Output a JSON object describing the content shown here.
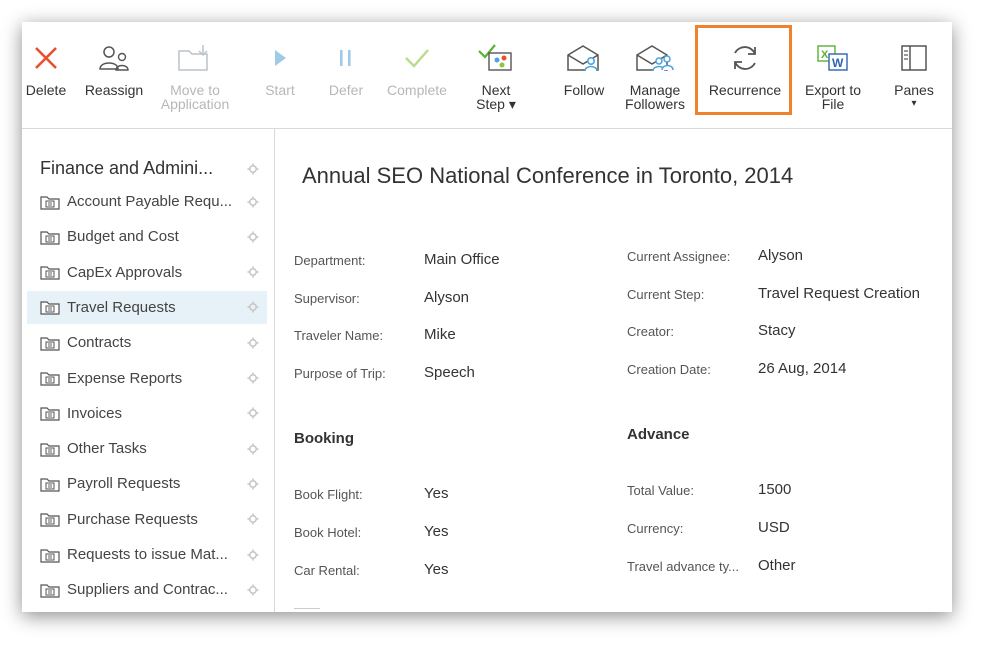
{
  "toolbar": {
    "delete": "Delete",
    "reassign": "Reassign",
    "move_to_app_1": "Move to",
    "move_to_app_2": "Application",
    "start": "Start",
    "defer": "Defer",
    "complete": "Complete",
    "next_step_1": "Next",
    "next_step_2": "Step ▾",
    "follow": "Follow",
    "manage_followers_1": "Manage",
    "manage_followers_2": "Followers",
    "recurrence": "Recurrence",
    "export_to_file_1": "Export to",
    "export_to_file_2": "File",
    "panes_1": "Panes",
    "panes_2": "▾"
  },
  "sidebar": {
    "title": "Finance and Admini...",
    "items": [
      {
        "label": "Account Payable Requ..."
      },
      {
        "label": "Budget and Cost"
      },
      {
        "label": "CapEx Approvals"
      },
      {
        "label": "Travel Requests"
      },
      {
        "label": "Contracts"
      },
      {
        "label": "Expense Reports"
      },
      {
        "label": "Invoices"
      },
      {
        "label": "Other Tasks"
      },
      {
        "label": "Payroll Requests"
      },
      {
        "label": "Purchase Requests"
      },
      {
        "label": "Requests to issue Mat..."
      },
      {
        "label": "Suppliers and Contrac..."
      }
    ]
  },
  "detail": {
    "title": "Annual SEO National Conference in Toronto, 2014",
    "left_fields": [
      {
        "label": "Department:",
        "value": "Main Office"
      },
      {
        "label": "Supervisor:",
        "value": "Alyson"
      },
      {
        "label": "Traveler Name:",
        "value": "Mike"
      },
      {
        "label": "Purpose of Trip:",
        "value": "Speech"
      }
    ],
    "right_fields": [
      {
        "label": "Current Assignee:",
        "value": "Alyson"
      },
      {
        "label": "Current Step:",
        "value": "Travel Request Creation"
      },
      {
        "label": "Creator:",
        "value": "Stacy"
      },
      {
        "label": "Creation Date:",
        "value": "26 Aug, 2014"
      }
    ],
    "booking_title": "Booking",
    "booking_fields": [
      {
        "label": "Book Flight:",
        "value": "Yes"
      },
      {
        "label": "Book Hotel:",
        "value": "Yes"
      },
      {
        "label": "Car Rental:",
        "value": "Yes"
      }
    ],
    "advance_title": "Advance",
    "advance_fields": [
      {
        "label": "Total Value:",
        "value": "1500"
      },
      {
        "label": "Currency:",
        "value": "USD"
      },
      {
        "label": "Travel advance ty...",
        "value": "Other"
      }
    ]
  },
  "colors": {
    "highlight": "#f0822d",
    "active_bg": "#e6f1f8",
    "delete_red": "#e8502c",
    "accent_blue": "#4aa3df",
    "complete_green": "#8cc63f"
  }
}
